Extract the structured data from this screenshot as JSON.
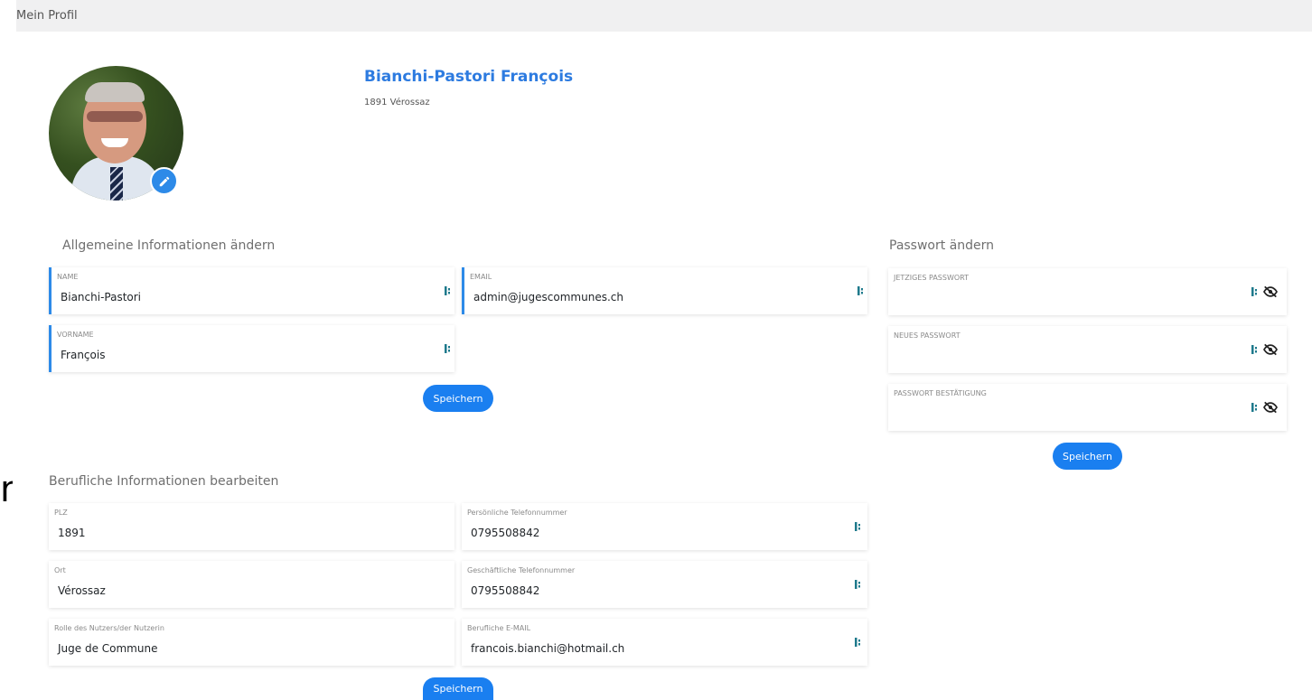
{
  "topbar": {
    "title": "Mein Profil"
  },
  "edge_glyph": "n",
  "profile": {
    "name": "Bianchi-Pastori François",
    "location": "1891 Vérossaz"
  },
  "general": {
    "title": "Allgemeine Informationen ändern",
    "name_label": "NAME",
    "name_value": "Bianchi-Pastori",
    "email_label": "EMAIL",
    "email_value": "admin@jugescommunes.ch",
    "firstname_label": "VORNAME",
    "firstname_value": "François",
    "save_label": "Speichern"
  },
  "password": {
    "title": "Passwort ändern",
    "current_label": "JETZIGES PASSWORT",
    "new_label": "NEUES PASSWORT",
    "confirm_label": "PASSWORT BESTÄTIGUNG",
    "save_label": "Speichern"
  },
  "professional": {
    "title": "Berufliche Informationen bearbeiten",
    "zip_label": "PLZ",
    "zip_value": "1891",
    "phone_label": "Persönliche Telefonnummer",
    "phone_value": "0795508842",
    "city_label": "Ort",
    "city_value": "Vérossaz",
    "work_phone_label": "Geschäftliche Telefonnummer",
    "work_phone_value": "0795508842",
    "role_label": "Rolle des Nutzers/der Nutzerin",
    "role_value": "Juge de Commune",
    "work_email_label": "Berufliche E-MAIL",
    "work_email_value": "francois.bianchi@hotmail.ch",
    "save_label": "Speichern"
  },
  "colors": {
    "accent": "#2d8ae8",
    "button": "#1a7ff0",
    "name": "#2d7be0"
  }
}
